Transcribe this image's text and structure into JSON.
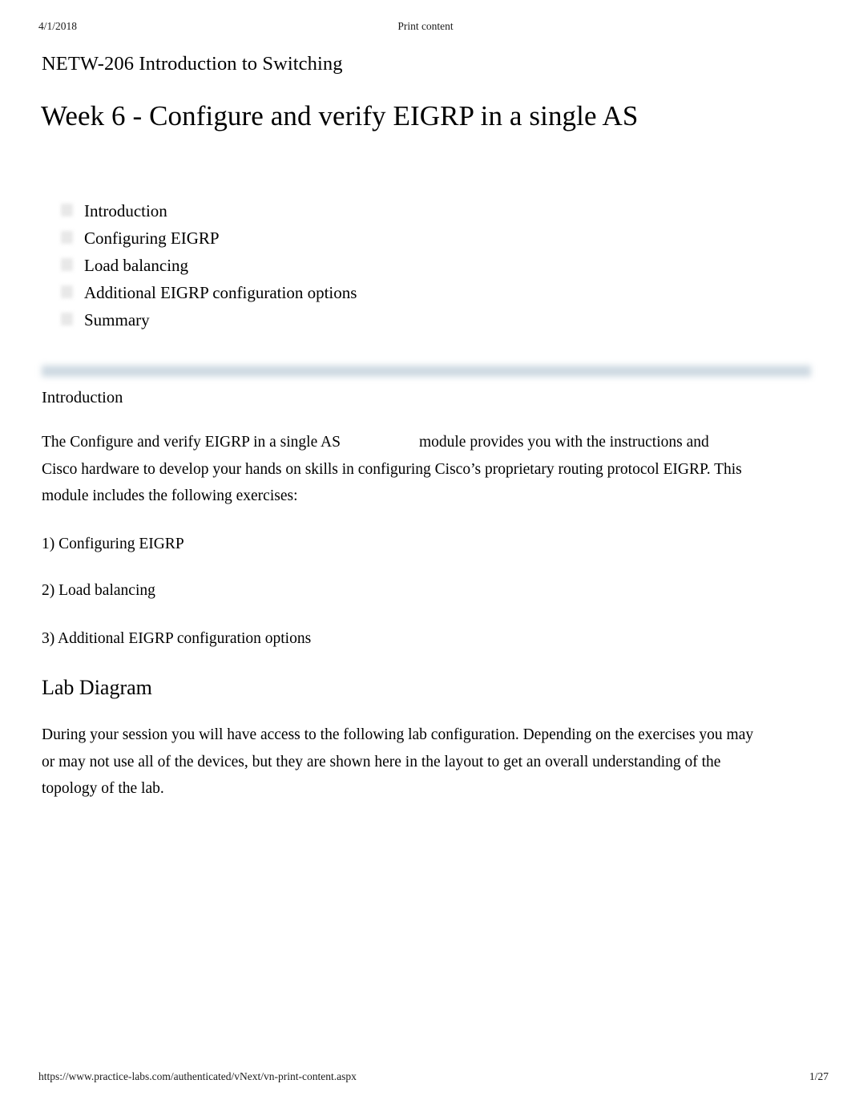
{
  "document": {
    "header": {
      "date": "4/1/2018",
      "title": "Print content"
    },
    "footer": {
      "url": "https://www.practice-labs.com/authenticated/vNext/vn-print-content.aspx",
      "page_indicator": "1/27"
    },
    "course_line": "NETW-206 Introduction to Switching",
    "module_title": "Week 6 - Configure and verify EIGRP in a single AS",
    "toc": {
      "items": [
        {
          "label": "Introduction",
          "bullet_icon": "square-bullet-icon"
        },
        {
          "label": "Configuring EIGRP",
          "bullet_icon": "square-bullet-icon"
        },
        {
          "label": "Load balancing",
          "bullet_icon": "square-bullet-icon"
        },
        {
          "label": "Additional EIGRP configuration options",
          "bullet_icon": "square-bullet-icon"
        },
        {
          "label": "Summary",
          "bullet_icon": "square-bullet-icon"
        }
      ]
    },
    "sections": {
      "introduction": {
        "heading": "Introduction",
        "paragraph_part1": "The  Configure and verify EIGRP in a single AS",
        "paragraph_part2": "module provides you with the instructions and Cisco hardware to develop your hands on skills in configuring Cisco’s proprietary routing protocol EIGRP. This module includes the following exercises:",
        "exercises": [
          "1) Configuring EIGRP",
          "2) Load balancing",
          "3) Additional EIGRP configuration options"
        ]
      },
      "lab_diagram": {
        "heading": "Lab Diagram",
        "paragraph": "During your session you will have access to the following lab configuration. Depending on the exercises you may or may not use all of the devices, but they are shown here in the layout to get an overall understanding of the topology of the lab."
      }
    },
    "colors": {
      "divider_bar": "#c7d4de",
      "text": "#000000",
      "background": "#ffffff",
      "bullet_placeholder": "#e4e4e4"
    }
  }
}
